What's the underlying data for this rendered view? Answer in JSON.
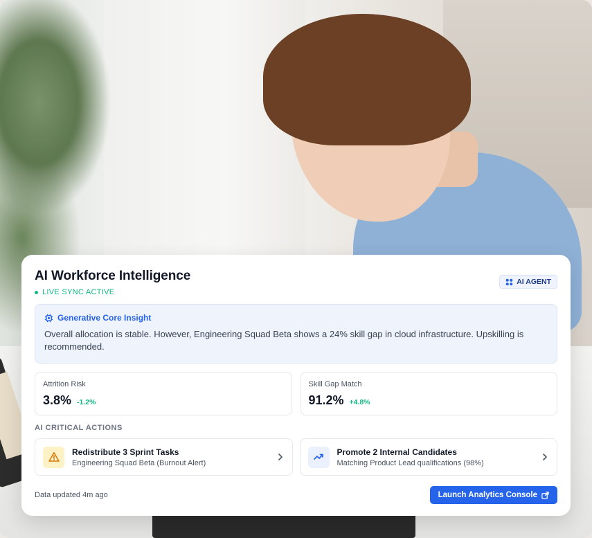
{
  "card": {
    "title": "AI Workforce Intelligence",
    "status": "LIVE SYNC ACTIVE",
    "badge": "AI AGENT"
  },
  "insight": {
    "heading": "Generative Core Insight",
    "text": "Overall allocation is stable. However, Engineering Squad Beta shows a 24% skill gap in cloud infrastructure. Upskilling is recommended."
  },
  "metrics": [
    {
      "label": "Attrition Risk",
      "value": "3.8%",
      "delta": "-1.2%"
    },
    {
      "label": "Skill Gap Match",
      "value": "91.2%",
      "delta": "+4.8%"
    }
  ],
  "actions": {
    "heading": "AI CRITICAL ACTIONS",
    "items": [
      {
        "title": "Redistribute 3 Sprint Tasks",
        "subtitle": "Engineering Squad Beta (Burnout Alert)",
        "icon": "warning-icon"
      },
      {
        "title": "Promote 2 Internal Candidates",
        "subtitle": "Matching Product Lead qualifications (98%)",
        "icon": "trending-up-icon"
      }
    ]
  },
  "footer": {
    "updated": "Data updated 4m ago",
    "button": "Launch Analytics Console"
  },
  "colors": {
    "accent": "#2563eb",
    "positive": "#10b981",
    "warning": "#f59e0b"
  }
}
